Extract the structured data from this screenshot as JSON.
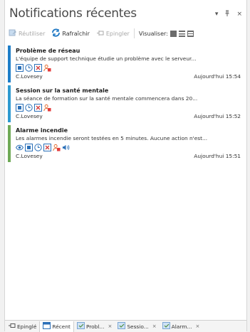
{
  "header": {
    "title": "Notifications récentes",
    "menu_icon": "▾",
    "pin_icon": "ᵠ",
    "close_icon": "×"
  },
  "toolbar": {
    "reuse_label": "Réutiliser",
    "refresh_label": "Rafraîchir",
    "pin_label": "Epingler",
    "view_label": "Visualiser:"
  },
  "notifications": [
    {
      "title": "Problème de réseau",
      "description": "L'équipe de support technique étudie un problème avec le serveur...",
      "author": "C.Lovesey",
      "time": "Aujourd'hui 15:54",
      "color": "#1e7ec8",
      "icons": [
        "square-icon",
        "clock-icon",
        "cancel-icon",
        "user-icon"
      ]
    },
    {
      "title": "Session sur la santé mentale",
      "description": "La séance de formation sur la santé mentale commencera dans 20...",
      "author": "C.Lovesey",
      "time": "Aujourd'hui 15:52",
      "color": "#2e9ad0",
      "icons": [
        "square-icon",
        "clock-icon",
        "cancel-icon",
        "user-icon"
      ]
    },
    {
      "title": "Alarme incendie",
      "description": "Les alarmes incendie seront testées en 5 minutes. Aucune action n'est...",
      "author": "C.Lovesey",
      "time": "Aujourd'hui 15:51",
      "color": "#6fa956",
      "icons": [
        "eye-icon",
        "square-icon",
        "clock-icon",
        "cancel-icon",
        "user-icon",
        "speaker-icon"
      ]
    }
  ],
  "bottom_tabs": {
    "pinned": "Epinglé",
    "recent": "Récent",
    "tab1": "Probl...",
    "tab2": "Sessio...",
    "tab3": "Alarm...",
    "close": "×"
  }
}
